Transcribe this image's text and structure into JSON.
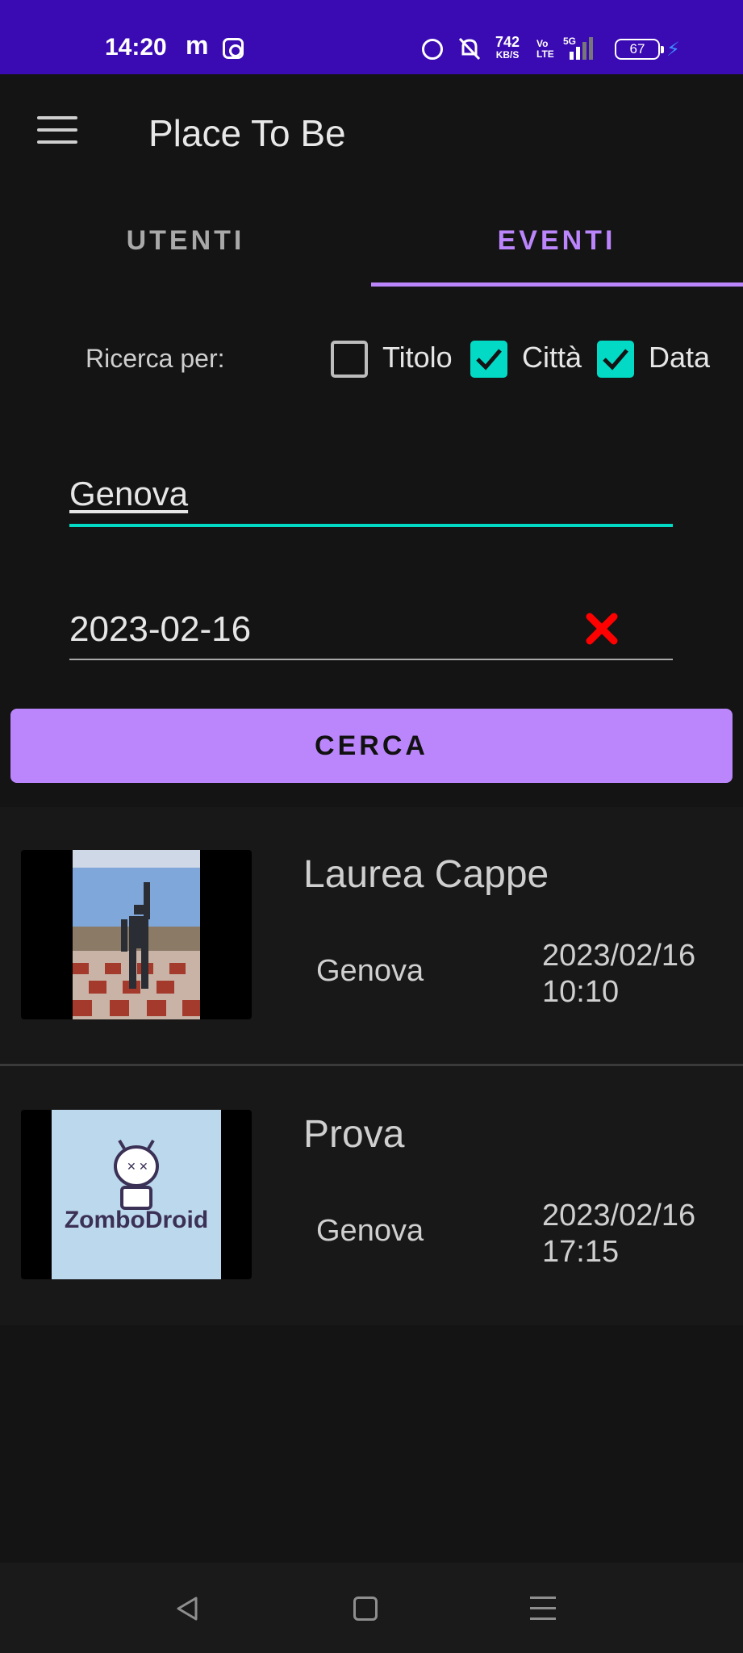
{
  "status_bar": {
    "time": "14:20",
    "app_icon_m": "m",
    "net_speed": "742",
    "net_speed_unit": "KB/S",
    "volte": "Vo\nLTE",
    "network": "5G",
    "battery": "67"
  },
  "app_bar": {
    "title": "Place To Be"
  },
  "tabs": [
    {
      "label": "UTENTI",
      "selected": false
    },
    {
      "label": "EVENTI",
      "selected": true
    }
  ],
  "search": {
    "label": "Ricerca per:",
    "options": [
      {
        "label": "Titolo",
        "checked": false
      },
      {
        "label": "Città",
        "checked": true
      },
      {
        "label": "Data",
        "checked": true
      }
    ],
    "city_value": "Genova",
    "date_value": "2023-02-16",
    "button_label": "CERCA"
  },
  "events": [
    {
      "title": "Laurea Cappe",
      "city": "Genova",
      "date": "2023/02/16",
      "time": "10:10",
      "thumb": "robot-simulation"
    },
    {
      "title": "Prova",
      "city": "Genova",
      "date": "2023/02/16",
      "time": "17:15",
      "thumb": "zombodroid-logo",
      "thumb_text": "ZomboDroid"
    }
  ],
  "colors": {
    "status_bar": "#3a0ab3",
    "accent": "#bb86fc",
    "teal": "#03dac5",
    "background": "#141414"
  }
}
